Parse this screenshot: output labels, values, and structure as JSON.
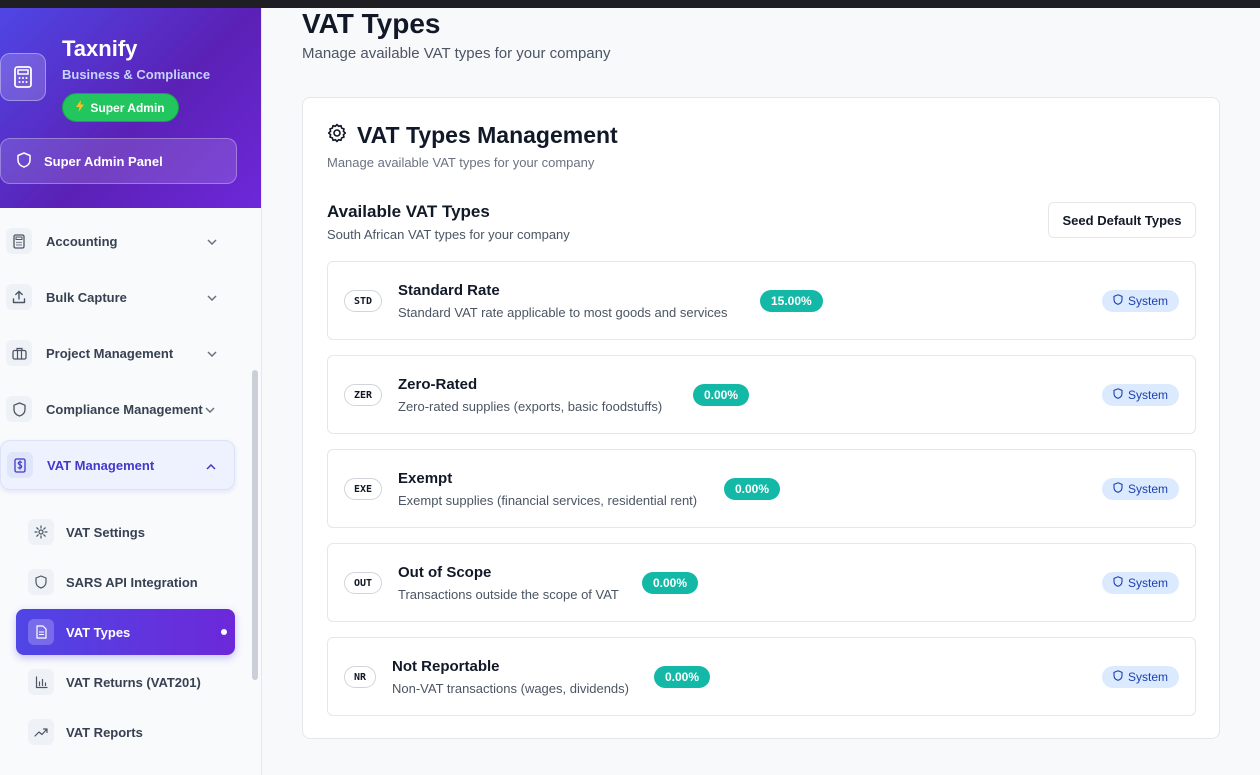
{
  "brand": {
    "name": "Taxnify",
    "tagline": "Business & Compliance",
    "role_badge": "Super Admin",
    "admin_panel": "Super Admin Panel"
  },
  "nav": {
    "items": [
      {
        "label": "Accounting",
        "icon": "calculator-icon"
      },
      {
        "label": "Bulk Capture",
        "icon": "upload-icon"
      },
      {
        "label": "Project Management",
        "icon": "briefcase-icon"
      },
      {
        "label": "Compliance Management",
        "icon": "shield-icon"
      },
      {
        "label": "VAT Management",
        "icon": "receipt-icon",
        "expanded": true
      }
    ],
    "sub_items": [
      {
        "label": "VAT Settings",
        "icon": "gear-icon"
      },
      {
        "label": "SARS API Integration",
        "icon": "shield-icon"
      },
      {
        "label": "VAT Types",
        "icon": "file-icon",
        "active": true
      },
      {
        "label": "VAT Returns (VAT201)",
        "icon": "bar-chart-icon"
      },
      {
        "label": "VAT Reports",
        "icon": "trend-icon"
      }
    ]
  },
  "page": {
    "title": "VAT Types",
    "subtitle": "Manage available VAT types for your company"
  },
  "card": {
    "title": "VAT Types Management",
    "subtitle": "Manage available VAT types for your company",
    "section_title": "Available VAT Types",
    "section_subtitle": "South African VAT types for your company",
    "seed_button": "Seed Default Types"
  },
  "vat_types": [
    {
      "code": "STD",
      "name": "Standard Rate",
      "description": "Standard VAT rate applicable to most goods and services",
      "rate": "15.00%",
      "badge": "System"
    },
    {
      "code": "ZER",
      "name": "Zero-Rated",
      "description": "Zero-rated supplies (exports, basic foodstuffs)",
      "rate": "0.00%",
      "badge": "System"
    },
    {
      "code": "EXE",
      "name": "Exempt",
      "description": "Exempt supplies (financial services, residential rent)",
      "rate": "0.00%",
      "badge": "System"
    },
    {
      "code": "OUT",
      "name": "Out of Scope",
      "description": "Transactions outside the scope of VAT",
      "rate": "0.00%",
      "badge": "System"
    },
    {
      "code": "NR",
      "name": "Not Reportable",
      "description": "Non-VAT transactions (wages, dividends)",
      "rate": "0.00%",
      "badge": "System"
    }
  ],
  "colors": {
    "brand_gradient_start": "#4f46e5",
    "brand_gradient_end": "#6d28d9",
    "rate_badge": "#14b8a6",
    "system_badge_bg": "#dbeafe",
    "super_admin_badge": "#22c55e"
  }
}
